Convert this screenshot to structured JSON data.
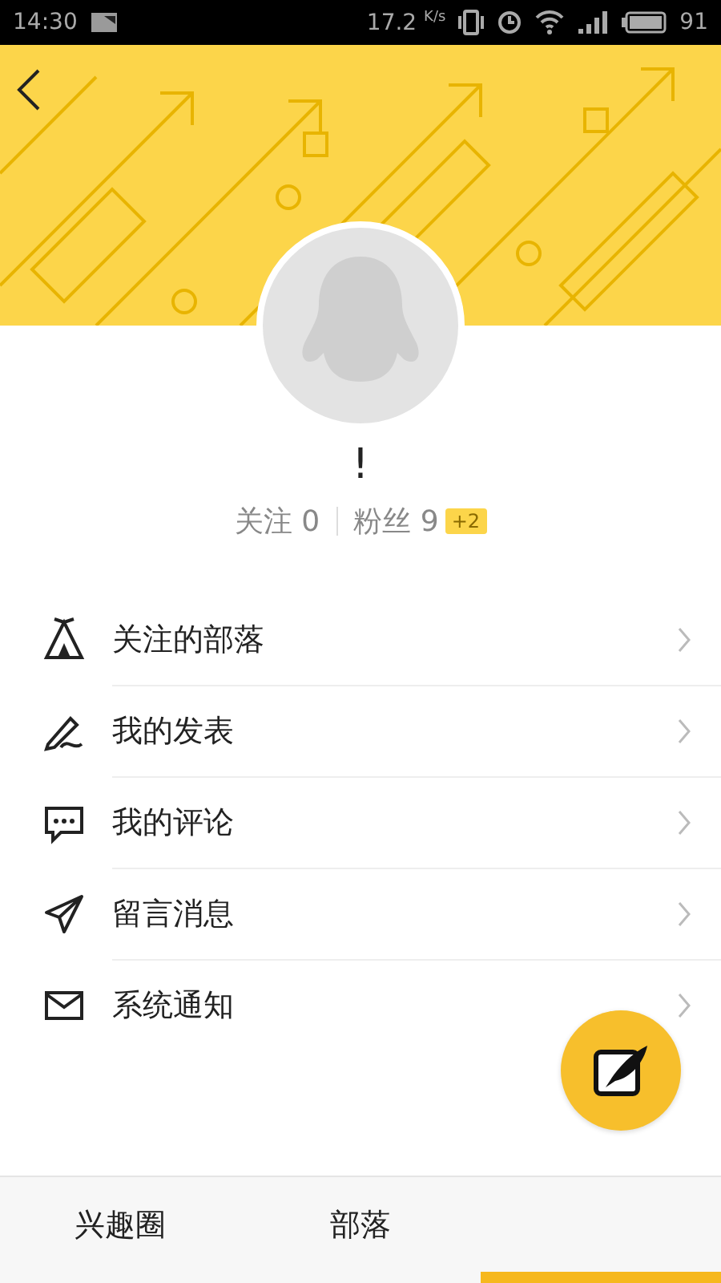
{
  "status_bar": {
    "time": "14:30",
    "speed": "17.2",
    "speed_unit": "K/s",
    "battery": "91"
  },
  "profile": {
    "name": "!",
    "following_label": "关注",
    "following": "0",
    "fans_label": "粉丝",
    "fans": "9",
    "fans_badge": "+2"
  },
  "menu": [
    {
      "label": "关注的部落"
    },
    {
      "label": "我的发表"
    },
    {
      "label": "我的评论"
    },
    {
      "label": "留言消息"
    },
    {
      "label": "系统通知"
    }
  ],
  "tabs": [
    {
      "label": "兴趣圈",
      "selected": false
    },
    {
      "label": "部落",
      "selected": false
    },
    {
      "selected": true
    }
  ]
}
